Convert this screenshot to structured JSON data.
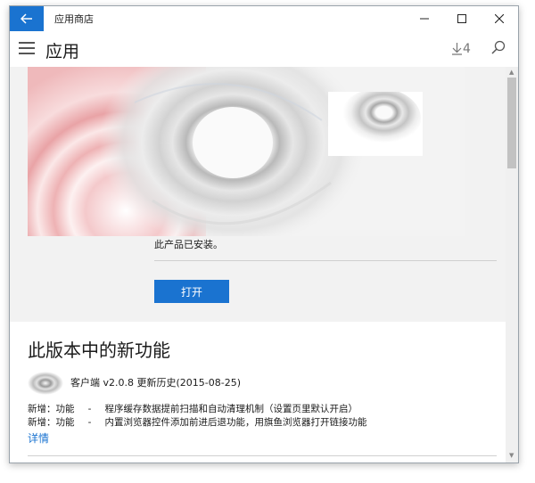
{
  "window": {
    "title": "应用商店"
  },
  "header": {
    "title": "应用",
    "downloads_count": "4"
  },
  "install": {
    "status_text": "此产品已安装。",
    "open_label": "打开"
  },
  "whats_new": {
    "title": "此版本中的新功能",
    "version_text": "客户端 v2.0.8 更新历史(2015-08-25)",
    "notes": [
      {
        "prefix": "新增：功能",
        "sep": "-",
        "text": "程序缓存数据提前扫描和自动清理机制（设置页里默认开启）"
      },
      {
        "prefix": "新增：功能",
        "sep": "-",
        "text": "内置浏览器控件添加前进后退功能，用旗鱼浏览器打开链接功能"
      }
    ],
    "details_link": "详情"
  },
  "icons": {
    "back": "back-arrow-icon",
    "minimize": "minimize-icon",
    "maximize": "maximize-icon",
    "close": "close-icon",
    "menu": "hamburger-menu-icon",
    "downloads": "download-arrow-icon",
    "search": "search-icon"
  },
  "colors": {
    "accent": "#1a73d0",
    "background": "#f2f2f2",
    "hero_red": "#e9a3a6"
  }
}
